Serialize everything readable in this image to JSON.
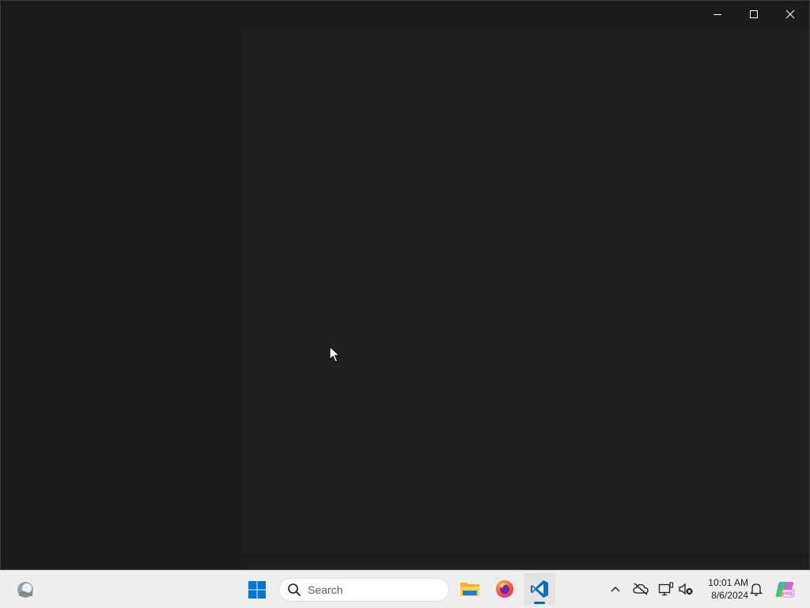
{
  "window": {
    "caption_buttons": [
      {
        "name": "minimize",
        "icon": "minimize-icon"
      },
      {
        "name": "maximize",
        "icon": "maximize-icon"
      },
      {
        "name": "close",
        "icon": "close-icon"
      }
    ]
  },
  "taskbar": {
    "search": {
      "placeholder": "Search",
      "icon": "search-icon"
    },
    "pinned_apps": [
      {
        "name": "File Explorer",
        "icon": "folder-icon"
      },
      {
        "name": "Firefox",
        "icon": "firefox-icon"
      },
      {
        "name": "Visual Studio Code",
        "icon": "vscode-icon",
        "active": true
      }
    ],
    "tray": {
      "icons": [
        "chevron-up-icon",
        "cloud-off-icon",
        "network-icon",
        "volume-muted-icon"
      ],
      "time": "10:01 AM",
      "date": "8/6/2024",
      "notification_icon": "bell-icon",
      "copilot_icon": "copilot-icon",
      "copilot_badge": "PRE"
    },
    "widgets_icon": "weather-icon"
  },
  "colors": {
    "window_bg": "#1b1b1b",
    "content_bg": "#202020",
    "taskbar_bg": "#eeeeee",
    "accent": "#0067c0"
  }
}
